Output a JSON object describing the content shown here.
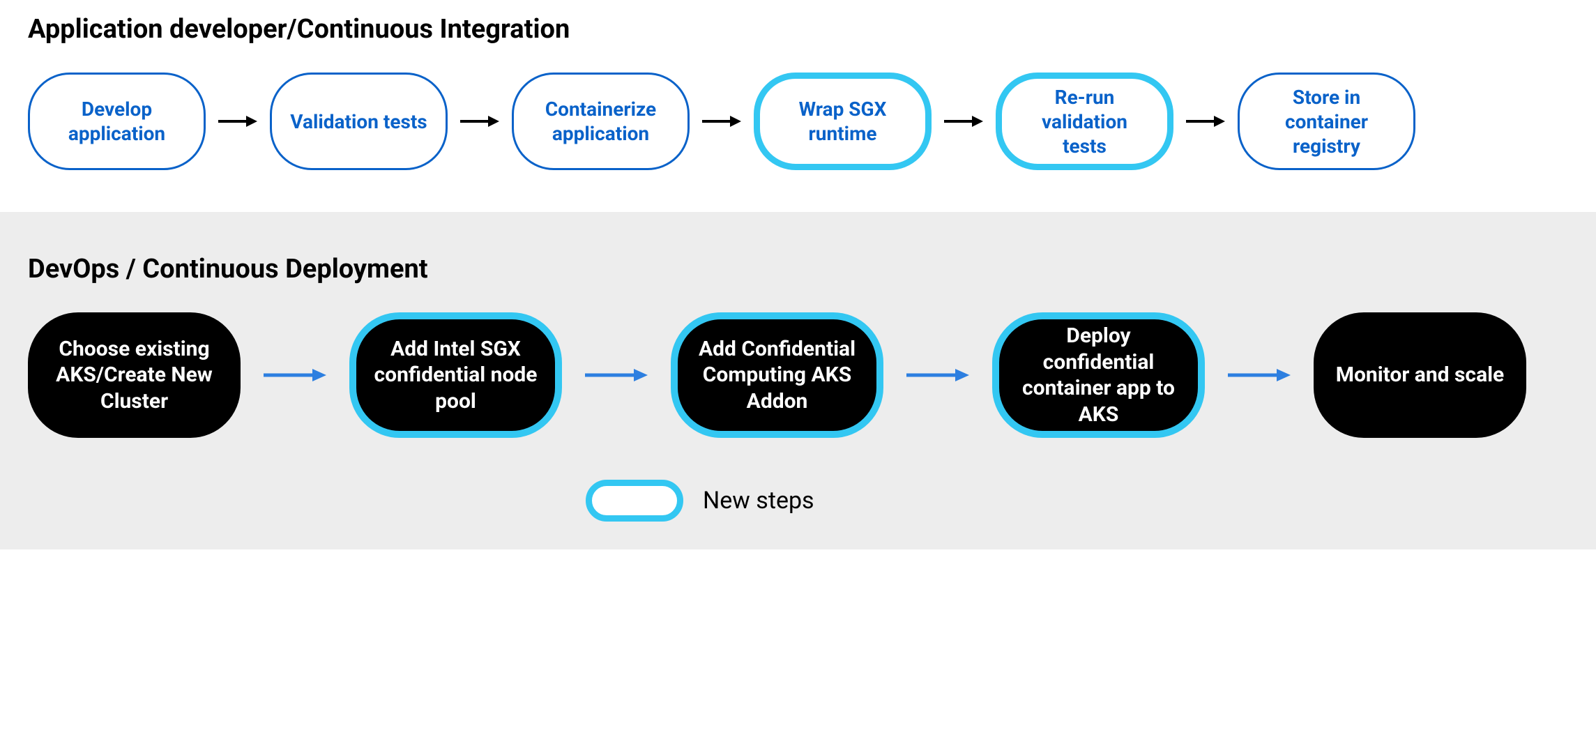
{
  "colors": {
    "accent_blue": "#0a62c9",
    "highlight_cyan": "#33c7f2",
    "dark_fill": "#000000",
    "cd_arrow": "#2d7fe0",
    "ci_arrow": "#000000"
  },
  "ci": {
    "title": "Application developer/Continuous Integration",
    "steps": [
      {
        "label": "Develop application",
        "new": false
      },
      {
        "label": "Validation tests",
        "new": false
      },
      {
        "label": "Containerize application",
        "new": false
      },
      {
        "label": "Wrap SGX runtime",
        "new": true
      },
      {
        "label": "Re-run validation tests",
        "new": true
      },
      {
        "label": "Store in container registry",
        "new": false
      }
    ]
  },
  "cd": {
    "title": "DevOps / Continuous Deployment",
    "steps": [
      {
        "label": "Choose existing AKS/Create New Cluster",
        "new": false
      },
      {
        "label": "Add Intel SGX confidential node pool",
        "new": true
      },
      {
        "label": "Add Confidential Computing AKS Addon",
        "new": true
      },
      {
        "label": "Deploy confidential container app to AKS",
        "new": true
      },
      {
        "label": "Monitor and scale",
        "new": false
      }
    ]
  },
  "legend": {
    "label": "New steps"
  }
}
